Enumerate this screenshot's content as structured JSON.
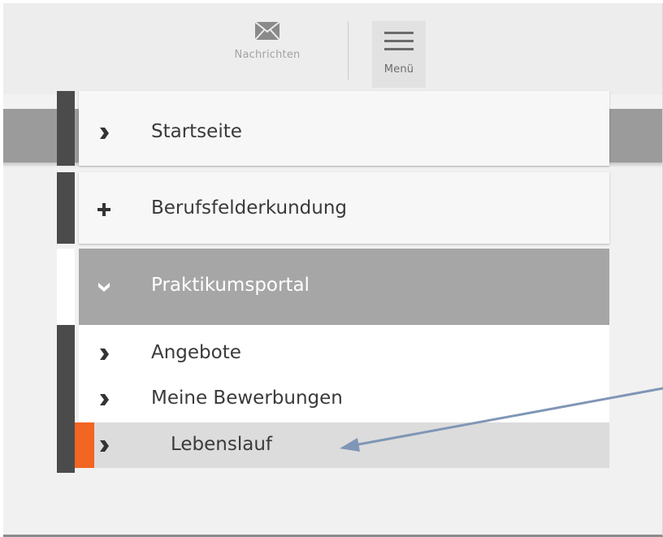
{
  "header": {
    "messages": {
      "label": "Nachrichten",
      "icon": "envelope-icon"
    },
    "menu": {
      "label": "Menü",
      "icon": "hamburger-menu-icon"
    }
  },
  "menu": {
    "items": [
      {
        "label": "Startseite",
        "icon": "chevron-right-icon"
      },
      {
        "label": "Berufsfelderkundung",
        "icon": "plus-icon"
      },
      {
        "label": "Praktikumsportal",
        "icon": "chevron-down-icon",
        "expanded": true,
        "children": [
          {
            "label": "Angebote",
            "icon": "chevron-right-icon"
          },
          {
            "label": "Meine Bewerbungen",
            "icon": "chevron-right-icon"
          },
          {
            "label": "Lebenslauf",
            "icon": "chevron-right-icon",
            "active": true
          }
        ]
      }
    ]
  },
  "colors": {
    "active_marker": "#f26522",
    "stripe": "#4b4b4b",
    "expanded_header": "#a6a6a6",
    "annotation_arrow": "#7f96b6"
  }
}
